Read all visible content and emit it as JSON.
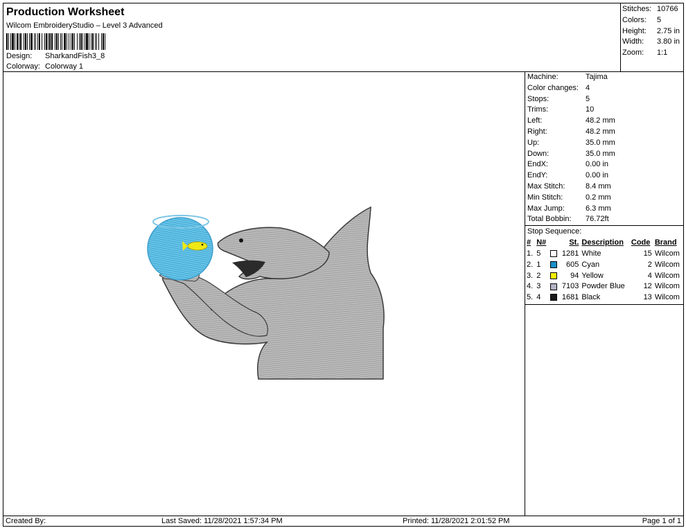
{
  "header": {
    "title": "Production Worksheet",
    "subtitle": "Wilcom EmbroideryStudio – Level 3 Advanced",
    "design_label": "Design:",
    "design_value": "SharkandFish3_8",
    "colorway_label": "Colorway:",
    "colorway_value": "Colorway 1"
  },
  "stats": [
    {
      "label": "Stitches:",
      "value": "10766"
    },
    {
      "label": "Colors:",
      "value": "5"
    },
    {
      "label": "Height:",
      "value": "2.75 in"
    },
    {
      "label": "Width:",
      "value": "3.80 in"
    },
    {
      "label": "Zoom:",
      "value": "1:1"
    }
  ],
  "machine_info": [
    {
      "label": "Machine:",
      "value": "Tajima"
    },
    {
      "label": "Color changes:",
      "value": "4"
    },
    {
      "label": "Stops:",
      "value": "5"
    },
    {
      "label": "Trims:",
      "value": "10"
    },
    {
      "label": "Left:",
      "value": "48.2 mm"
    },
    {
      "label": "Right:",
      "value": "48.2 mm"
    },
    {
      "label": "Up:",
      "value": "35.0 mm"
    },
    {
      "label": "Down:",
      "value": "35.0 mm"
    },
    {
      "label": "EndX:",
      "value": "0.00 in"
    },
    {
      "label": "EndY:",
      "value": "0.00 in"
    },
    {
      "label": "Max Stitch:",
      "value": "8.4 mm"
    },
    {
      "label": "Min Stitch:",
      "value": "0.2 mm"
    },
    {
      "label": "Max Jump:",
      "value": "6.3 mm"
    },
    {
      "label": "Total Bobbin:",
      "value": "76.72ft"
    }
  ],
  "stop_sequence": {
    "title": "Stop Sequence:",
    "headers": {
      "num": "#",
      "n": "N#",
      "st": "St.",
      "description": "Description",
      "code": "Code",
      "brand": "Brand"
    },
    "rows": [
      {
        "num": "1.",
        "n": "5",
        "color": "#ffffff",
        "st": "1281",
        "description": "White",
        "code": "15",
        "brand": "Wilcom"
      },
      {
        "num": "2.",
        "n": "1",
        "color": "#1a8fc9",
        "st": "605",
        "description": "Cyan",
        "code": "2",
        "brand": "Wilcom"
      },
      {
        "num": "3.",
        "n": "2",
        "color": "#f5f000",
        "st": "94",
        "description": "Yellow",
        "code": "4",
        "brand": "Wilcom"
      },
      {
        "num": "4.",
        "n": "3",
        "color": "#b3b3c6",
        "st": "7103",
        "description": "Powder Blue",
        "code": "12",
        "brand": "Wilcom"
      },
      {
        "num": "5.",
        "n": "4",
        "color": "#1a1a1a",
        "st": "1681",
        "description": "Black",
        "code": "13",
        "brand": "Wilcom"
      }
    ]
  },
  "footer": {
    "created_by": "Created By:",
    "last_saved": "Last Saved: 11/28/2021 1:57:34 PM",
    "printed": "Printed: 11/28/2021 2:01:52 PM",
    "page": "Page 1 of 1"
  }
}
